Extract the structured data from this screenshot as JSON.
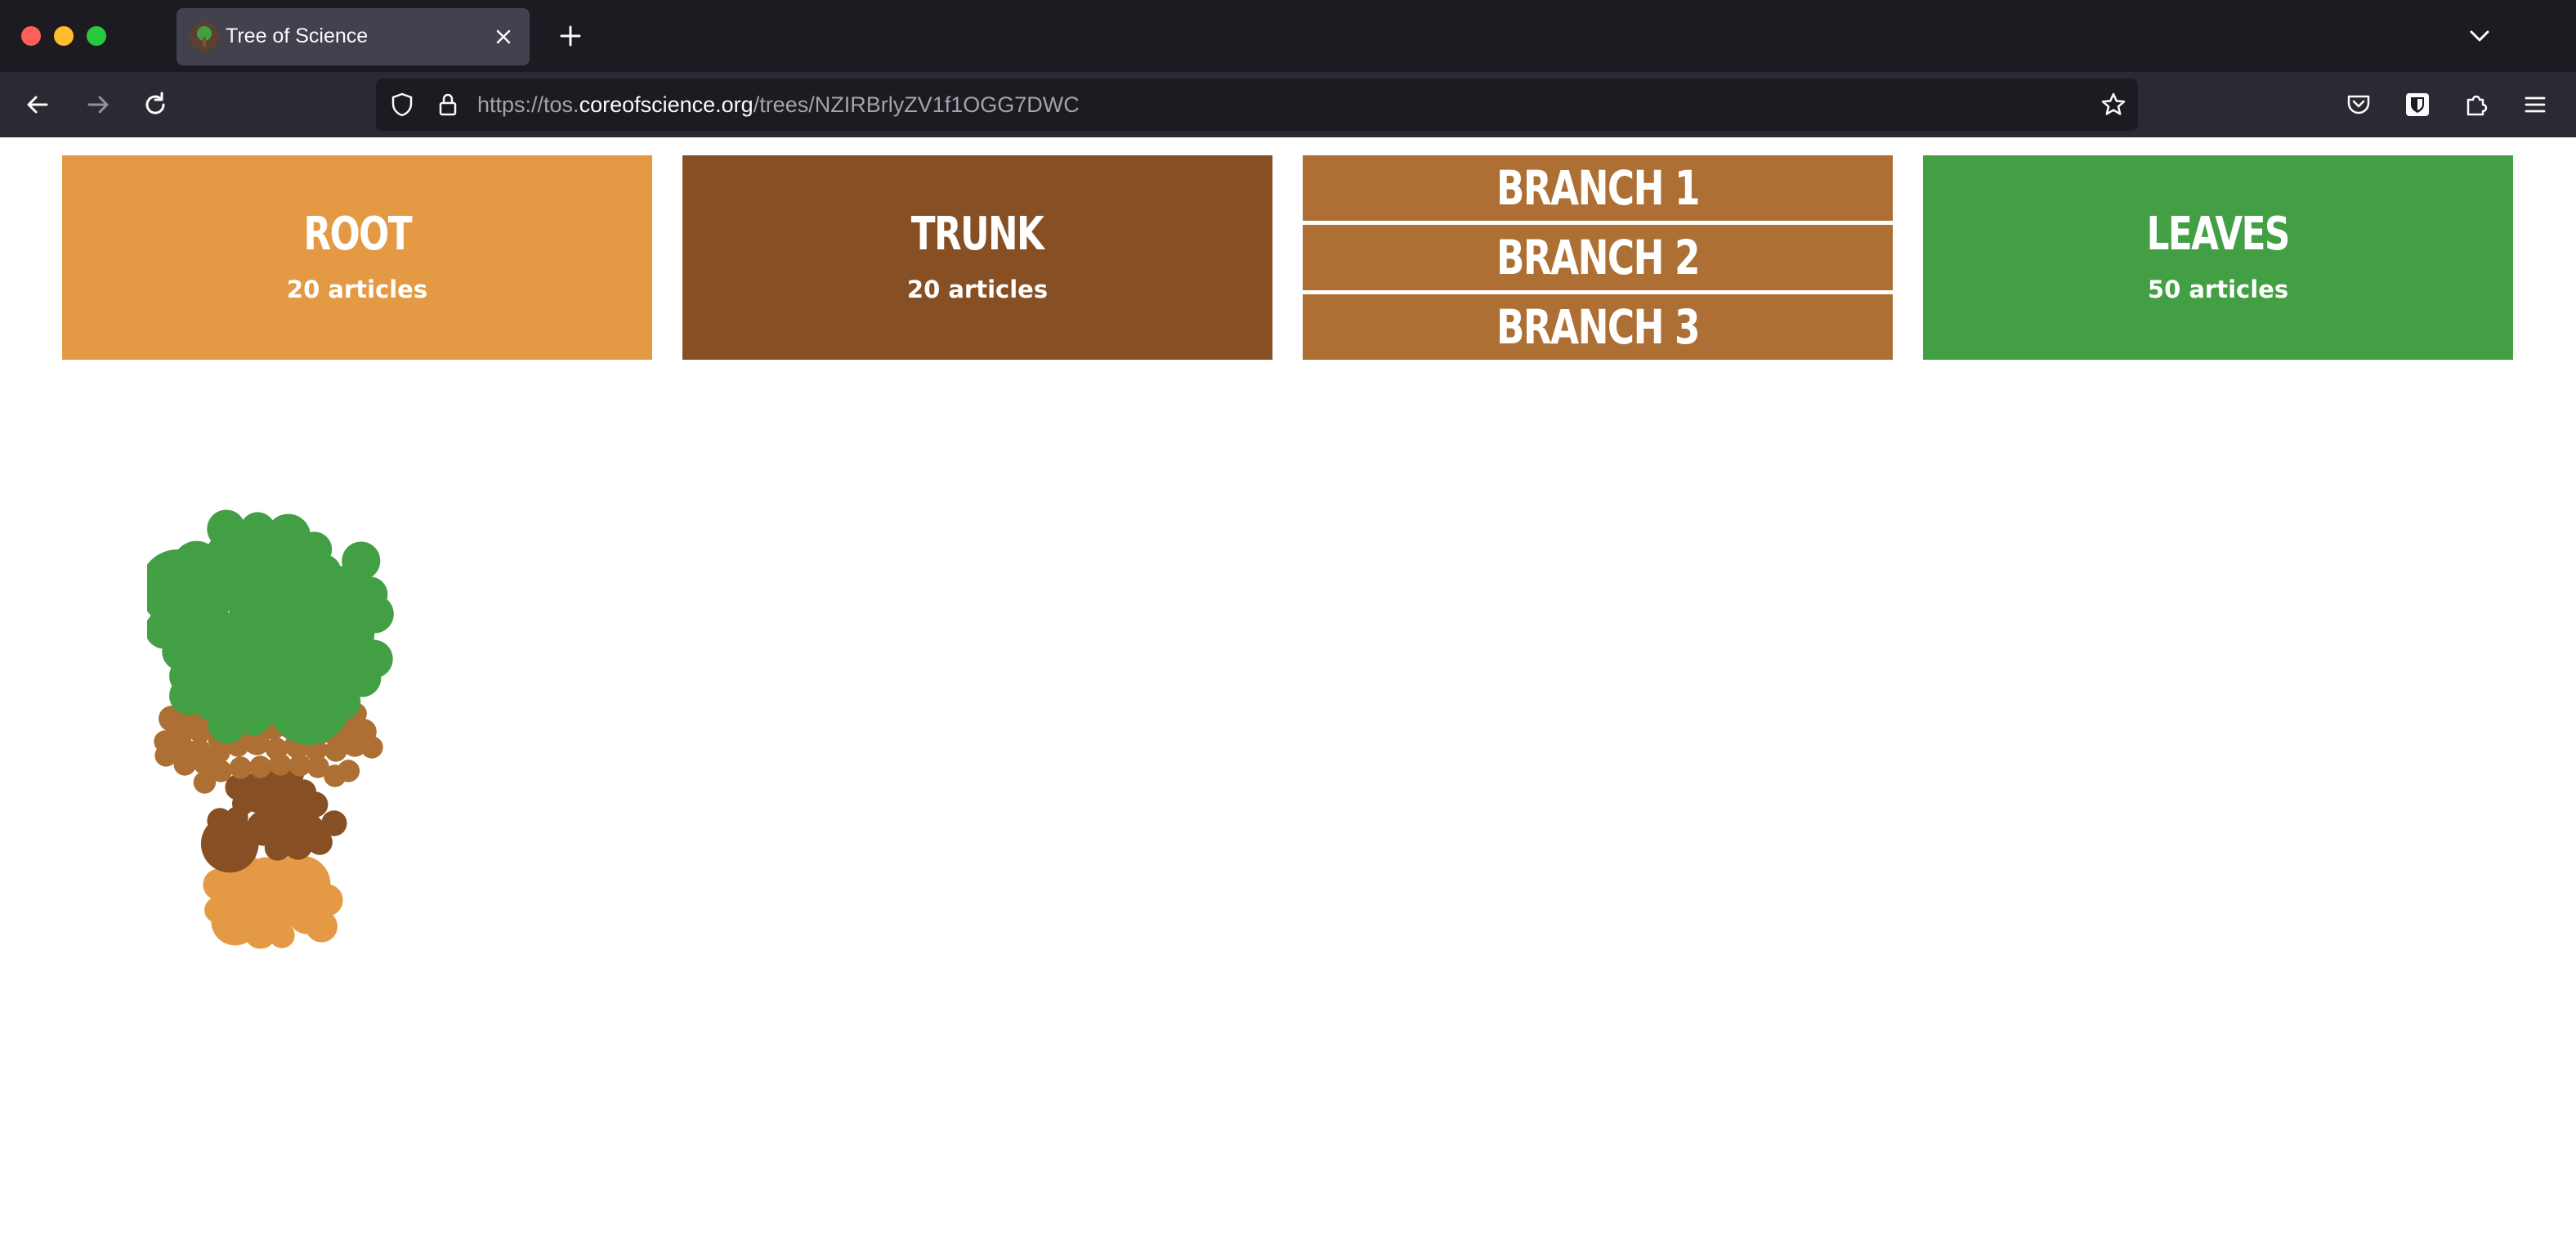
{
  "browser": {
    "tab_title": "Tree of Science",
    "url_prefix": "https://tos.",
    "url_domain": "coreofscience.org",
    "url_path": "/trees/NZIRBrlyZV1f1OGG7DWC"
  },
  "cards": {
    "root": {
      "title": "ROOT",
      "subtitle": "20 articles"
    },
    "trunk": {
      "title": "TRUNK",
      "subtitle": "20 articles"
    },
    "branches": [
      {
        "title": "BRANCH 1"
      },
      {
        "title": "BRANCH 2"
      },
      {
        "title": "BRANCH 3"
      }
    ],
    "leaves": {
      "title": "LEAVES",
      "subtitle": "50 articles"
    }
  },
  "colors": {
    "root": "#e49a45",
    "trunk": "#874f24",
    "branch": "#ad6f33",
    "leaves": "#439f44"
  },
  "tree_counts": {
    "leaves": 50,
    "branches": 40,
    "trunk": 20,
    "root": 20
  }
}
